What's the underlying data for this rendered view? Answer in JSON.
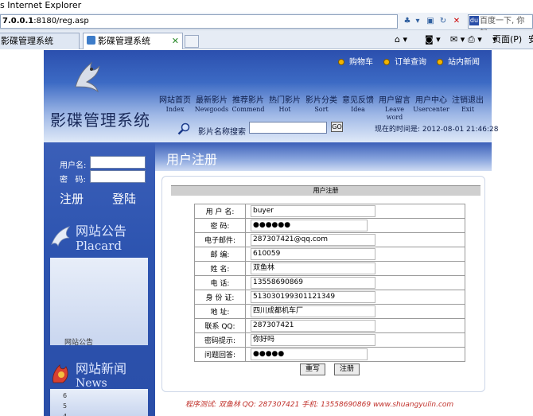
{
  "browser": {
    "window_title": "s Internet Explorer",
    "address_host": "7.0.0.1",
    "address_rest": ":8180/reg.asp",
    "search_placeholder": "百度一下, 你就",
    "tabs": [
      {
        "label": "影碟管理系统"
      },
      {
        "label": "影碟管理系统"
      }
    ],
    "tools": {
      "page_menu": "页面(P)",
      "safety_menu": "安"
    }
  },
  "site": {
    "title": "影碟管理系统",
    "top_links": [
      {
        "label": "购物车"
      },
      {
        "label": "订单查询"
      },
      {
        "label": "站内新闻"
      }
    ],
    "nav": [
      {
        "zh": "网站首页",
        "en": "Index"
      },
      {
        "zh": "最新影片",
        "en": "Newgoods"
      },
      {
        "zh": "推荐影片",
        "en": "Commend"
      },
      {
        "zh": "热门影片",
        "en": "Hot"
      },
      {
        "zh": "影片分类",
        "en": "Sort"
      },
      {
        "zh": "意见反馈",
        "en": "Idea"
      },
      {
        "zh": "用户留言",
        "en": "Leave word"
      },
      {
        "zh": "用户中心",
        "en": "Usercenter"
      },
      {
        "zh": "注销退出",
        "en": "Exit"
      }
    ],
    "search": {
      "label": "影片名称搜索",
      "go": "GO"
    },
    "clock": "现在的时间是: 2012-08-01 21:46:28"
  },
  "sidebar": {
    "username_label": "用户名:",
    "password_label": "密   码:",
    "register": "注册",
    "login": "登陆",
    "notice_title": "网站公告",
    "notice_en": "Placard",
    "notice_text": "网站公告",
    "news_title": "网站新闻",
    "news_en": "News",
    "news_items": [
      "6",
      "5",
      "4"
    ]
  },
  "main": {
    "page_title": "用户注册",
    "panel_title": "用户注册",
    "fields": [
      {
        "label": "用 户 名:",
        "value": "buyer"
      },
      {
        "label": "密    码:",
        "value": "●●●●●●"
      },
      {
        "label": "电子邮件:",
        "value": "287307421@qq.com"
      },
      {
        "label": "邮    编:",
        "value": "610059"
      },
      {
        "label": "姓    名:",
        "value": "双鱼林"
      },
      {
        "label": "电    话:",
        "value": "13558690869"
      },
      {
        "label": "身 份 证:",
        "value": "513030199301121349"
      },
      {
        "label": "地    址:",
        "value": "四川成都机车厂"
      },
      {
        "label": "联系  QQ:",
        "value": "287307421"
      },
      {
        "label": "密码提示:",
        "value": "你好吗"
      },
      {
        "label": "问题回答:",
        "value": "●●●●●"
      }
    ],
    "reset_button": "重写",
    "submit_button": "注册",
    "footer": "程序测试: 双鱼林  QQ: 287307421  手机: 13558690869  www.shuangyulin.com"
  },
  "colors": {
    "header_blue": "#2b4fae",
    "sidebar_blue": "#2d54b0",
    "footer_red": "#c0302a"
  }
}
